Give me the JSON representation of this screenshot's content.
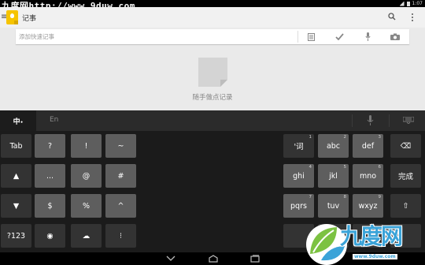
{
  "status_bar": {
    "watermark_text": "九度网http://www.9duw.com",
    "time": "1:07"
  },
  "app_bar": {
    "title": "记事"
  },
  "quick_note": {
    "placeholder": "添加快速记事"
  },
  "empty_state": {
    "text": "随手做点记录"
  },
  "keyboard": {
    "lang_cn": "中",
    "lang_en": "En",
    "rows": [
      {
        "left": [
          {
            "label": "Tab",
            "style": "dark"
          },
          {
            "label": "?",
            "style": "gray"
          },
          {
            "label": "!",
            "style": "gray"
          },
          {
            "label": "~",
            "style": "gray"
          }
        ],
        "right": [
          {
            "label": "'词",
            "num": "1",
            "style": "dark"
          },
          {
            "label": "abc",
            "num": "2",
            "style": "gray"
          },
          {
            "label": "def",
            "num": "3",
            "style": "gray"
          },
          {
            "label": "⌫",
            "style": "dark",
            "icon": "backspace-icon"
          }
        ]
      },
      {
        "left": [
          {
            "label": "▲",
            "style": "dark",
            "icon": "up-arrow-icon"
          },
          {
            "label": "...",
            "style": "gray"
          },
          {
            "label": "@",
            "style": "gray"
          },
          {
            "label": "#",
            "style": "gray"
          }
        ],
        "right": [
          {
            "label": "ghi",
            "num": "4",
            "style": "gray"
          },
          {
            "label": "jkl",
            "num": "5",
            "style": "gray"
          },
          {
            "label": "mno",
            "num": "6",
            "style": "gray"
          },
          {
            "label": "完成",
            "style": "dark"
          }
        ]
      },
      {
        "left": [
          {
            "label": "▼",
            "style": "dark",
            "icon": "down-arrow-icon"
          },
          {
            "label": "$",
            "style": "gray"
          },
          {
            "label": "%",
            "style": "gray"
          },
          {
            "label": "^",
            "style": "gray"
          }
        ],
        "right": [
          {
            "label": "pqrs",
            "num": "7",
            "style": "gray"
          },
          {
            "label": "tuv",
            "num": "8",
            "style": "gray"
          },
          {
            "label": "wxyz",
            "num": "9",
            "style": "gray"
          },
          {
            "label": "⇧",
            "style": "dark",
            "icon": "shift-icon"
          }
        ]
      },
      {
        "left": [
          {
            "label": "?123",
            "style": "dark"
          },
          {
            "label": "◉",
            "style": "dark",
            "icon": "globe-icon"
          },
          {
            "label": "☁",
            "style": "dark",
            "icon": "emoticon-icon"
          },
          {
            "label": "⁝",
            "style": "dark",
            "icon": "settings-icon"
          }
        ],
        "right": [
          {
            "label": "",
            "style": "dark"
          },
          {
            "label": "",
            "style": "dark"
          },
          {
            "label": "",
            "style": "dark"
          },
          {
            "label": "",
            "style": "dark"
          }
        ]
      }
    ]
  },
  "watermark": {
    "brand": "九度网",
    "url": "www.9duw.com",
    "color": "#3aa3d8"
  }
}
